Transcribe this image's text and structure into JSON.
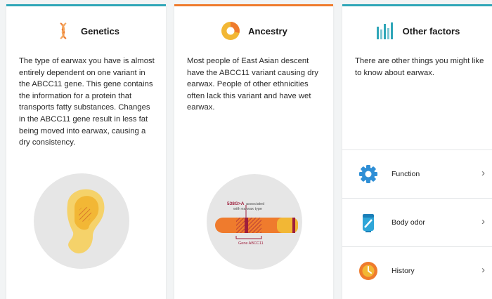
{
  "cards": {
    "genetics": {
      "title": "Genetics",
      "icon": "dna-icon",
      "accent": "#2fa6b8",
      "description": "The type of earwax you have is almost entirely dependent on one variant in the ABCC11 gene. This gene contains the information for a protein that transports fatty substances. Changes in the ABCC11 gene result in less fat being moved into earwax, causing a dry consistency."
    },
    "ancestry": {
      "title": "Ancestry",
      "icon": "ancestry-pie-icon",
      "accent": "#ef7b2d",
      "description": "Most people of East Asian descent have the ABCC11 variant causing dry earwax. People of other ethnicities often lack this variant and have wet earwax.",
      "diagram": {
        "variant": "538G>A",
        "associated_text": "associated",
        "associated_text2": "with earwax type",
        "gene_label": "Gene ABCC11"
      }
    },
    "other": {
      "title": "Other factors",
      "icon": "bars-icon",
      "accent": "#2fa6b8",
      "description": "There are other things you might like to know about earwax.",
      "items": [
        {
          "label": "Function",
          "icon": "gear-icon"
        },
        {
          "label": "Body odor",
          "icon": "deodorant-icon"
        },
        {
          "label": "History",
          "icon": "history-icon"
        }
      ]
    }
  }
}
